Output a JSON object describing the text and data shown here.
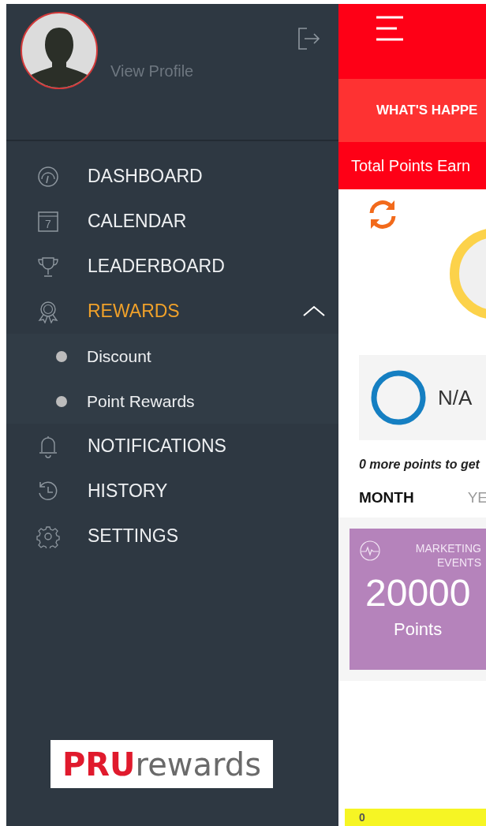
{
  "drawer": {
    "profile_link": "View Profile",
    "menu": [
      {
        "kind": "item",
        "label": "DASHBOARD",
        "selected": false
      },
      {
        "kind": "item",
        "icon_text": "7",
        "label": "CALENDAR",
        "selected": false
      },
      {
        "kind": "item",
        "label": "LEADERBOARD",
        "selected": false
      },
      {
        "kind": "group",
        "label": "REWARDS",
        "selected": true,
        "expanded": true,
        "children": [
          {
            "label": "Discount"
          },
          {
            "label": "Point Rewards"
          }
        ]
      },
      {
        "kind": "item",
        "label": "NOTIFICATIONS",
        "selected": false
      },
      {
        "kind": "item",
        "label": "HISTORY",
        "selected": false
      },
      {
        "kind": "item",
        "label": "SETTINGS",
        "selected": false
      }
    ],
    "logo": {
      "brand": "PRU",
      "text": "rewards"
    }
  },
  "main": {
    "banner": "WHAT'S HAPPE",
    "total_points": "Total Points Earn",
    "status": "N/A",
    "hint": "0 more points to get",
    "tabs": [
      {
        "label": "MONTH",
        "selected": true
      },
      {
        "label": "YE",
        "selected": false
      }
    ],
    "card": {
      "title": "MARKETING EVENTS",
      "value": "20000",
      "unit": "Points",
      "color": "#b583bb"
    },
    "footer_value": "0"
  }
}
